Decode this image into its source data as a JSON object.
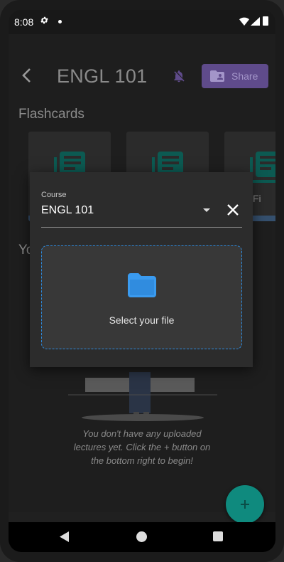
{
  "status_bar": {
    "time": "8:08",
    "icons": [
      "gear-icon",
      "notification-dot",
      "wifi-icon",
      "signal-icon",
      "battery-icon"
    ]
  },
  "header": {
    "title": "ENGL 101",
    "share_label": "Share"
  },
  "flashcards": {
    "title": "Flashcards",
    "cards": [
      {
        "label": ""
      },
      {
        "label": ""
      },
      {
        "label": "Fi"
      }
    ]
  },
  "lectures": {
    "title_partial": "Yo",
    "empty_message": "You don't have any uploaded lectures yet. Click the + button on the bottom right to begin!"
  },
  "dialog": {
    "course_label": "Course",
    "course_value": "ENGL 101",
    "dropzone_text": "Select your file"
  },
  "colors": {
    "accent_purple": "#5f4b8b",
    "teal": "#0f8a7e",
    "dropzone_border": "#2d8ce0",
    "folder_icon": "#3a9bf0"
  }
}
